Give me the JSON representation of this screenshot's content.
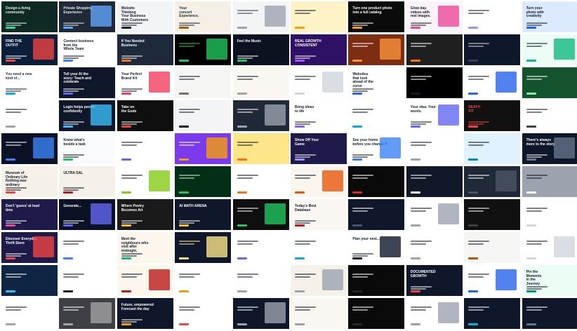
{
  "grid": {
    "rows": 10,
    "cols": 10,
    "tiles": [
      {
        "bg": "#0f2a24",
        "fg": "#d8f5e6",
        "accent": "#34d399",
        "text": "Design a living\ncommunity"
      },
      {
        "bg": "#1f2937",
        "fg": "#e5e7eb",
        "accent": "#60a5fa",
        "text": "Private Shopping\nExperience"
      },
      {
        "bg": "#f3f4f6",
        "fg": "#111827",
        "accent": "#111827",
        "text": "Website\nThinking\nYour Business\nWith Customers"
      },
      {
        "bg": "#f5efe6",
        "fg": "#1f2937",
        "accent": "#a16207",
        "text": "Your\nconcert\nExperience."
      },
      {
        "bg": "#f3f4f6",
        "fg": "#374151",
        "accent": "#9ca3af",
        "text": ""
      },
      {
        "bg": "#fef3c7",
        "fg": "#111827",
        "accent": "#f59e0b",
        "text": ""
      },
      {
        "bg": "#0b0b0b",
        "fg": "#ffffff",
        "accent": "#f59e0b",
        "text": "Turn one product photo\ninto a full catalog"
      },
      {
        "bg": "#fdf2f8",
        "fg": "#111827",
        "accent": "#ec4899",
        "text": "Glow day.\nvideos with\nreel images."
      },
      {
        "bg": "#ffffff",
        "fg": "#111827",
        "accent": "#a78bfa",
        "text": ""
      },
      {
        "bg": "#dbeafe",
        "fg": "#111827",
        "accent": "#2563eb",
        "text": "Turn your\nphoto with\ncreativity"
      },
      {
        "bg": "#0b1e3a",
        "fg": "#ffffff",
        "accent": "#ef4444",
        "text": "FIND THE\nOUTFIT"
      },
      {
        "bg": "#ffffff",
        "fg": "#111827",
        "accent": "#3b82f6",
        "text": "Connect business\nfrom the\nWhole Team"
      },
      {
        "bg": "#1e293b",
        "fg": "#ffffff",
        "accent": "#f97316",
        "text": "If You Needed\nBusiness"
      },
      {
        "bg": "#000000",
        "fg": "#22c55e",
        "accent": "#22c55e",
        "text": ""
      },
      {
        "bg": "#0b1220",
        "fg": "#ffffff",
        "accent": "#22c55e",
        "text": "Feel the Music"
      },
      {
        "bg": "#2e1065",
        "fg": "#ffffff",
        "accent": "#a855f7",
        "text": "REAL GROWTH\nCONSISTENT"
      },
      {
        "bg": "#7c2d12",
        "fg": "#ffffff",
        "accent": "#fb923c",
        "text": ""
      },
      {
        "bg": "#1f1f1f",
        "fg": "#ffffff",
        "accent": "#f97316",
        "text": ""
      },
      {
        "bg": "#0f172a",
        "fg": "#cbd5e1",
        "accent": "#334155",
        "text": ""
      },
      {
        "bg": "#ecfdf5",
        "fg": "#111827",
        "accent": "#10b981",
        "text": ""
      },
      {
        "bg": "#ffffff",
        "fg": "#1f2937",
        "accent": "#0ea5e9",
        "text": "You need a new\nkind of..."
      },
      {
        "bg": "#0f172a",
        "fg": "#ffffff",
        "accent": "#6366f1",
        "text": "Tell your AI the\nstory: Teach and\ncelebrate"
      },
      {
        "bg": "#ffffff",
        "fg": "#111827",
        "accent": "#f43f5e",
        "text": "Your Perfect\nBrand Kit"
      },
      {
        "bg": "#f5f5f4",
        "fg": "#111827",
        "accent": "#78716c",
        "text": ""
      },
      {
        "bg": "#faf7f2",
        "fg": "#111827",
        "accent": "#a8a29e",
        "text": ""
      },
      {
        "bg": "#ffffff",
        "fg": "#111827",
        "accent": "#d1d5db",
        "text": ""
      },
      {
        "bg": "#ffffff",
        "fg": "#111827",
        "accent": "#2563eb",
        "text": "Websites\nthat look\nahead of the\ncurve"
      },
      {
        "bg": "#000000",
        "fg": "#ffffff",
        "accent": "#111827",
        "text": ""
      },
      {
        "bg": "#ffffff",
        "fg": "#111827",
        "accent": "#2563eb",
        "text": ""
      },
      {
        "bg": "#14532d",
        "fg": "#ffffff",
        "accent": "#86efac",
        "text": ""
      },
      {
        "bg": "#ffffff",
        "fg": "#111827",
        "accent": "#9ca3af",
        "text": ""
      },
      {
        "bg": "#0f172a",
        "fg": "#ffffff",
        "accent": "#38bdf8",
        "text": "Login helps people\nconfidently"
      },
      {
        "bg": "#0f0f0f",
        "fg": "#ffffff",
        "accent": "#ef4444",
        "text": "Take on\nthe Gods"
      },
      {
        "bg": "#f3f4f6",
        "fg": "#111827",
        "accent": "#111827",
        "text": ""
      },
      {
        "bg": "#1f2937",
        "fg": "#ffffff",
        "accent": "#9ca3af",
        "text": ""
      },
      {
        "bg": "#ffffff",
        "fg": "#111827",
        "accent": "#8b5cf6",
        "text": "Bring ideas\nto life"
      },
      {
        "bg": "#ffffff",
        "fg": "#111827",
        "accent": "#0ea5e9",
        "text": ""
      },
      {
        "bg": "#ffffff",
        "fg": "#111827",
        "accent": "#6366f1",
        "text": "Your idea. Your\nwords."
      },
      {
        "bg": "#111111",
        "fg": "#ef4444",
        "accent": "#ef4444",
        "text": "DEATH\nPIT"
      },
      {
        "bg": "#ffffff",
        "fg": "#111827",
        "accent": "#374151",
        "text": ""
      },
      {
        "bg": "#0b1226",
        "fg": "#ffffff",
        "accent": "#3b82f6",
        "text": ""
      },
      {
        "bg": "#f8fafc",
        "fg": "#111827",
        "accent": "#22c55e",
        "text": "Know what's\nbeside a task"
      },
      {
        "bg": "#ffffff",
        "fg": "#111827",
        "accent": "#6366f1",
        "text": ""
      },
      {
        "bg": "#7c3aed",
        "fg": "#ffffff",
        "accent": "#f59e0b",
        "text": ""
      },
      {
        "bg": "#fde68a",
        "fg": "#111827",
        "accent": "#f97316",
        "text": ""
      },
      {
        "bg": "#1e1b4b",
        "fg": "#ffffff",
        "accent": "#a78bfa",
        "text": "Show Off Your\nGame"
      },
      {
        "bg": "#ffffff",
        "fg": "#111827",
        "accent": "#3b82f6",
        "text": "See your home\nbefore you change it"
      },
      {
        "bg": "#ffffff",
        "fg": "#111827",
        "accent": "#9ca3af",
        "text": ""
      },
      {
        "bg": "#e0f2fe",
        "fg": "#111827",
        "accent": "#0284c7",
        "text": ""
      },
      {
        "bg": "#0f172a",
        "fg": "#ffffff",
        "accent": "#64748b",
        "text": "There's always\nmore to the story."
      },
      {
        "bg": "#f5f0e8",
        "fg": "#111827",
        "accent": "#ef4444",
        "text": "Museum of\nOrdinary Life\nNothing was\nordinary"
      },
      {
        "bg": "#f5f0e8",
        "fg": "#111827",
        "accent": "#b91c1c",
        "text": "ULTRA SAL"
      },
      {
        "bg": "#ffffff",
        "fg": "#111827",
        "accent": "#84cc16",
        "text": ""
      },
      {
        "bg": "#052e16",
        "fg": "#bbf7d0",
        "accent": "#22c55e",
        "text": ""
      },
      {
        "bg": "#ffffff",
        "fg": "#111827",
        "accent": "#f97316",
        "text": ""
      },
      {
        "bg": "#faf5ee",
        "fg": "#111827",
        "accent": "#ea580c",
        "text": ""
      },
      {
        "bg": "#0a0a0a",
        "fg": "#ffffff",
        "accent": "#dc2626",
        "text": ""
      },
      {
        "bg": "#111827",
        "fg": "#ffffff",
        "accent": "#f9fafb",
        "text": ""
      },
      {
        "bg": "#1f2937",
        "fg": "#ffffff",
        "accent": "#4b5563",
        "text": ""
      },
      {
        "bg": "#9ca3af",
        "fg": "#111827",
        "accent": "#ffffff",
        "text": ""
      },
      {
        "bg": "#1e1b4b",
        "fg": "#ffffff",
        "accent": "#ec4899",
        "text": "Don't 'guess' at lead\ntime"
      },
      {
        "bg": "#0b1226",
        "fg": "#ffffff",
        "accent": "#6366f1",
        "text": "Generate..."
      },
      {
        "bg": "#1a1a1a",
        "fg": "#ffffff",
        "accent": "#fbbf24",
        "text": "Where Poetry\nBecomes Art"
      },
      {
        "bg": "#0f172a",
        "fg": "#ffffff",
        "accent": "#fbbf24",
        "text": "AI MATH ARENA"
      },
      {
        "bg": "#0f0f0f",
        "fg": "#ffffff",
        "accent": "#22c55e",
        "text": ""
      },
      {
        "bg": "#faf7f2",
        "fg": "#111827",
        "accent": "#b91c1c",
        "text": "Today's Best\nDatabase"
      },
      {
        "bg": "#0f172a",
        "fg": "#ffffff",
        "accent": "#475569",
        "text": ""
      },
      {
        "bg": "#ffffff",
        "fg": "#111827",
        "accent": "#9ca3af",
        "text": ""
      },
      {
        "bg": "#111111",
        "fg": "#ffffff",
        "accent": "#3f3f46",
        "text": ""
      },
      {
        "bg": "#ffffff",
        "fg": "#111827",
        "accent": "#d1d5db",
        "text": ""
      },
      {
        "bg": "#1e1b4b",
        "fg": "#ffffff",
        "accent": "#ef4444",
        "text": "Discover Everyday\nThrift Store"
      },
      {
        "bg": "#ffffff",
        "fg": "#111827",
        "accent": "#3b82f6",
        "text": ""
      },
      {
        "bg": "#fdf6ec",
        "fg": "#111827",
        "accent": "#10b981",
        "text": "Meet the\nneighbours who\nvisit after\nmidnight."
      },
      {
        "bg": "#0f172a",
        "fg": "#fde68a",
        "accent": "#fde68a",
        "text": ""
      },
      {
        "bg": "#ffffff",
        "fg": "#111827",
        "accent": "#6366f1",
        "text": ""
      },
      {
        "bg": "#ffffff",
        "fg": "#111827",
        "accent": "#0ea5e9",
        "text": ""
      },
      {
        "bg": "#ffffff",
        "fg": "#111827",
        "accent": "#0f172a",
        "text": "Plan your next..."
      },
      {
        "bg": "#ffffff",
        "fg": "#111827",
        "accent": "#9ca3af",
        "text": ""
      },
      {
        "bg": "#f5f5f4",
        "fg": "#111827",
        "accent": "#b45309",
        "text": ""
      },
      {
        "bg": "#ffffff",
        "fg": "#111827",
        "accent": "#d1d5db",
        "text": ""
      },
      {
        "bg": "#0f2544",
        "fg": "#ffffff",
        "accent": "#38bdf8",
        "text": ""
      },
      {
        "bg": "#ffffff",
        "fg": "#111827",
        "accent": "#111827",
        "text": ""
      },
      {
        "bg": "#fdf6ec",
        "fg": "#111827",
        "accent": "#b91c1c",
        "text": ""
      },
      {
        "bg": "#ffffff",
        "fg": "#111827",
        "accent": "#f59e0b",
        "text": ""
      },
      {
        "bg": "#ffffff",
        "fg": "#111827",
        "accent": "#9ca3af",
        "text": ""
      },
      {
        "bg": "#f5f0e8",
        "fg": "#111827",
        "accent": "#9ca3af",
        "text": ""
      },
      {
        "bg": "#0a0a0a",
        "fg": "#ffffff",
        "accent": "#262626",
        "text": ""
      },
      {
        "bg": "#0f172a",
        "fg": "#ffffff",
        "accent": "#ef4444",
        "text": "DOCUMENTED\nGROWTH"
      },
      {
        "bg": "#ffffff",
        "fg": "#111827",
        "accent": "#2563eb",
        "text": ""
      },
      {
        "bg": "#ecfdf5",
        "fg": "#111827",
        "accent": "#059669",
        "text": "Pin the\nMoments\nin the\nJourney"
      },
      {
        "bg": "#ffffff",
        "fg": "#111827",
        "accent": "#9ca3af",
        "text": ""
      },
      {
        "bg": "#3f3f46",
        "fg": "#ffffff",
        "accent": "#a3a3a3",
        "text": ""
      },
      {
        "bg": "#0f172a",
        "fg": "#ffffff",
        "accent": "#f59e0b",
        "text": "Future, empowered\nForecast the day"
      },
      {
        "bg": "#ffffff",
        "fg": "#111827",
        "accent": "#ef4444",
        "text": ""
      },
      {
        "bg": "#0f172a",
        "fg": "#ffffff",
        "accent": "#9ca3af",
        "text": ""
      },
      {
        "bg": "#faf7f2",
        "fg": "#111827",
        "accent": "#9ca3af",
        "text": ""
      },
      {
        "bg": "#0a0a0a",
        "fg": "#ffffff",
        "accent": "#27272a",
        "text": ""
      },
      {
        "bg": "#ffffff",
        "fg": "#111827",
        "accent": "#9ca3af",
        "text": ""
      },
      {
        "bg": "#0f172a",
        "fg": "#ffffff",
        "accent": "#06b6d4",
        "text": ""
      },
      {
        "bg": "#0f172a",
        "fg": "#ffffff",
        "accent": "#64748b",
        "text": ""
      }
    ]
  }
}
